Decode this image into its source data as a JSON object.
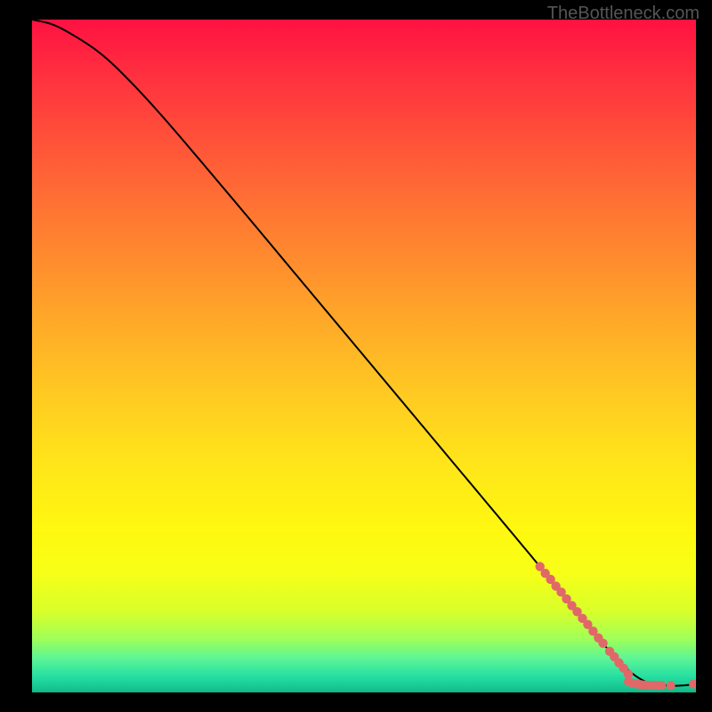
{
  "watermark": "TheBottleneck.com",
  "colors": {
    "curve": "#000000",
    "marker_fill": "#e06868",
    "marker_stroke": "#e06868",
    "background_black": "#000000",
    "watermark_text": "#555555"
  },
  "chart_data": {
    "type": "line",
    "title": "",
    "xlabel": "",
    "ylabel": "",
    "xlim": [
      0,
      100
    ],
    "ylim": [
      0,
      100
    ],
    "curve": {
      "x": [
        0,
        3,
        6,
        10,
        14,
        20,
        30,
        40,
        50,
        60,
        70,
        76,
        80,
        84,
        88,
        92,
        96,
        100
      ],
      "y": [
        100,
        99.3,
        97.8,
        95.2,
        91.6,
        85.2,
        73.6,
        61.8,
        50.0,
        38.2,
        26.4,
        19.3,
        14.5,
        9.8,
        5.0,
        1.8,
        1.0,
        1.2
      ]
    },
    "marker_cluster_line": {
      "x": [
        76.5,
        77.3,
        78.1,
        78.9,
        79.7,
        80.5,
        81.3,
        82.1,
        82.9,
        83.7,
        84.5,
        85.3,
        86.0
      ],
      "y": [
        18.7,
        17.7,
        16.8,
        15.8,
        14.9,
        13.9,
        12.9,
        12.0,
        11.0,
        10.1,
        9.1,
        8.1,
        7.3
      ]
    },
    "marker_cluster_gap": {
      "x": [
        87.0,
        87.7,
        88.4,
        89.1,
        89.8
      ],
      "y": [
        6.1,
        5.3,
        4.4,
        3.6,
        2.7
      ]
    },
    "marker_cluster_flat": {
      "x": [
        89.8,
        90.3,
        90.8,
        91.3,
        91.8,
        92.3,
        92.8,
        93.3,
        93.8,
        94.3,
        94.8
      ],
      "y": [
        1.6,
        1.4,
        1.3,
        1.2,
        1.15,
        1.1,
        1.08,
        1.06,
        1.05,
        1.04,
        1.03
      ]
    },
    "marker_singletons": {
      "x": [
        96.2,
        99.6
      ],
      "y": [
        1.02,
        1.25
      ]
    }
  }
}
